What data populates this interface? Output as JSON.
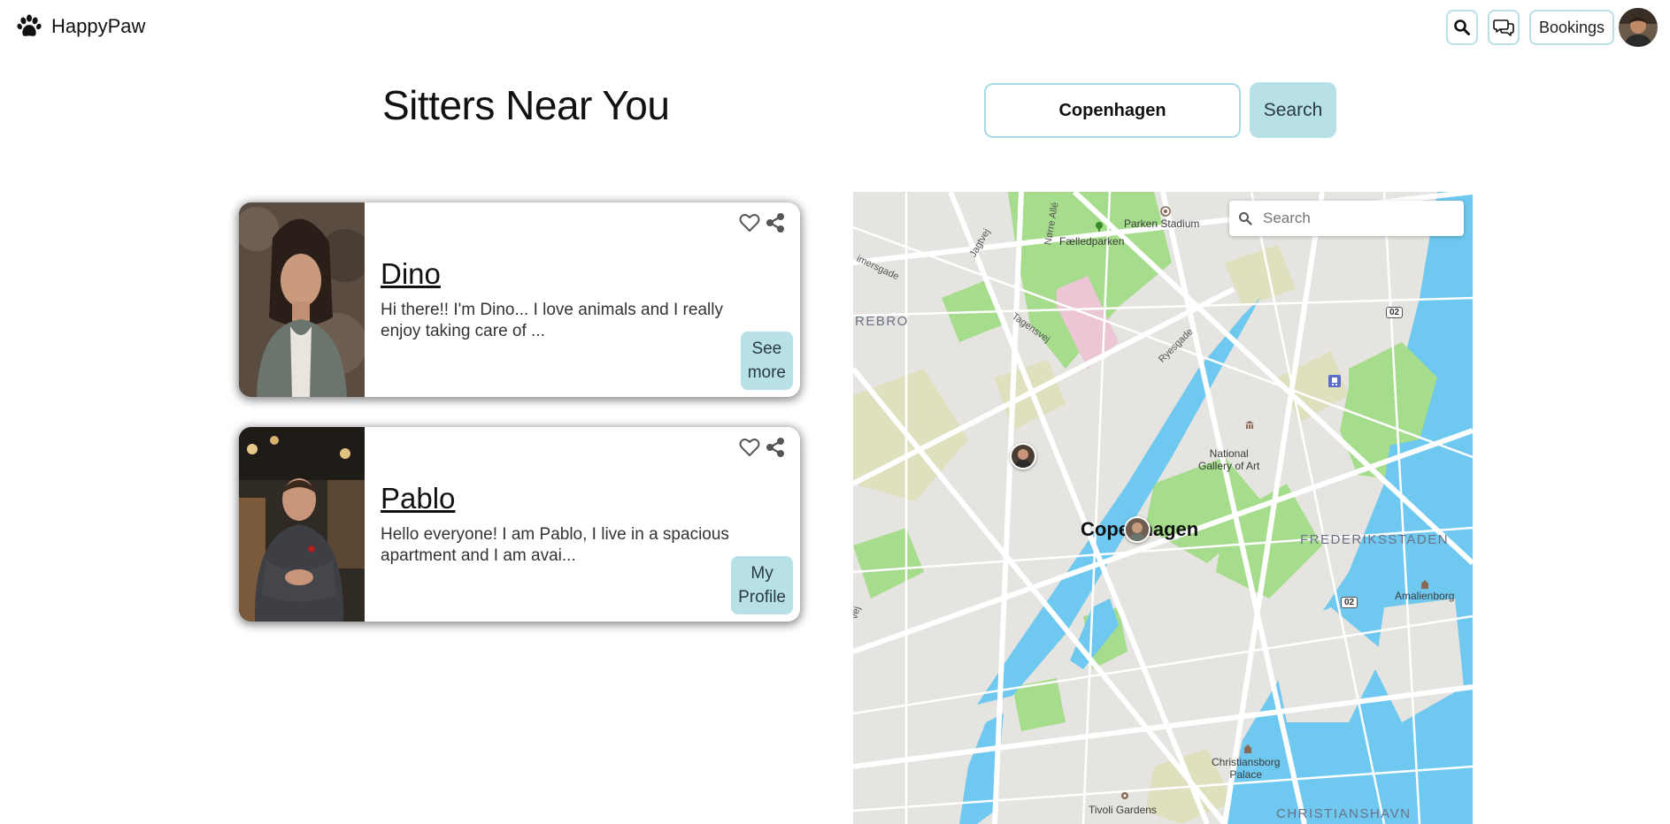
{
  "header": {
    "brand": "HappyPaw",
    "bookings_label": "Bookings"
  },
  "main": {
    "title": "Sitters Near You",
    "city_value": "Copenhagen",
    "search_label": "Search"
  },
  "sitters": [
    {
      "name": "Dino",
      "description": "Hi there!! I'm Dino... I love animals and I really enjoy taking care of ...",
      "button_label": "See\nmore"
    },
    {
      "name": "Pablo",
      "description": "Hello everyone! I am Pablo, I live in a spacious apartment and I am avai...",
      "button_label": "My\nProfile"
    }
  ],
  "map": {
    "search_placeholder": "Search",
    "labels": {
      "parken": "Parken Stadium",
      "faelledparken": "Fælledparken",
      "norre_alle": "Nørre Allé",
      "jagtvej": "Jagtvej",
      "tagensvej": "Tagensvej",
      "ryesgade": "Ryesgade",
      "timersgade": "imersgade",
      "norrebro": "REBRO",
      "city": "Copenhagen",
      "national_gallery": "National\nGallery of Art",
      "frederiksstaden": "FREDERIKSSTADEN",
      "amalienborg": "Amalienborg",
      "christiansborg": "Christiansborg\nPalace",
      "tivoli": "Tivoli Gardens",
      "christianshavn": "CHRISTIANSHAVN",
      "route_1": "02",
      "route_2": "02",
      "vej": "vej"
    }
  },
  "colors": {
    "accent": "#b7e0e7",
    "accent_border": "#a8dbe3",
    "water": "#6ec8ef",
    "park": "#a5dd8c",
    "land": "#e6e4e0",
    "road": "#ffffff"
  }
}
